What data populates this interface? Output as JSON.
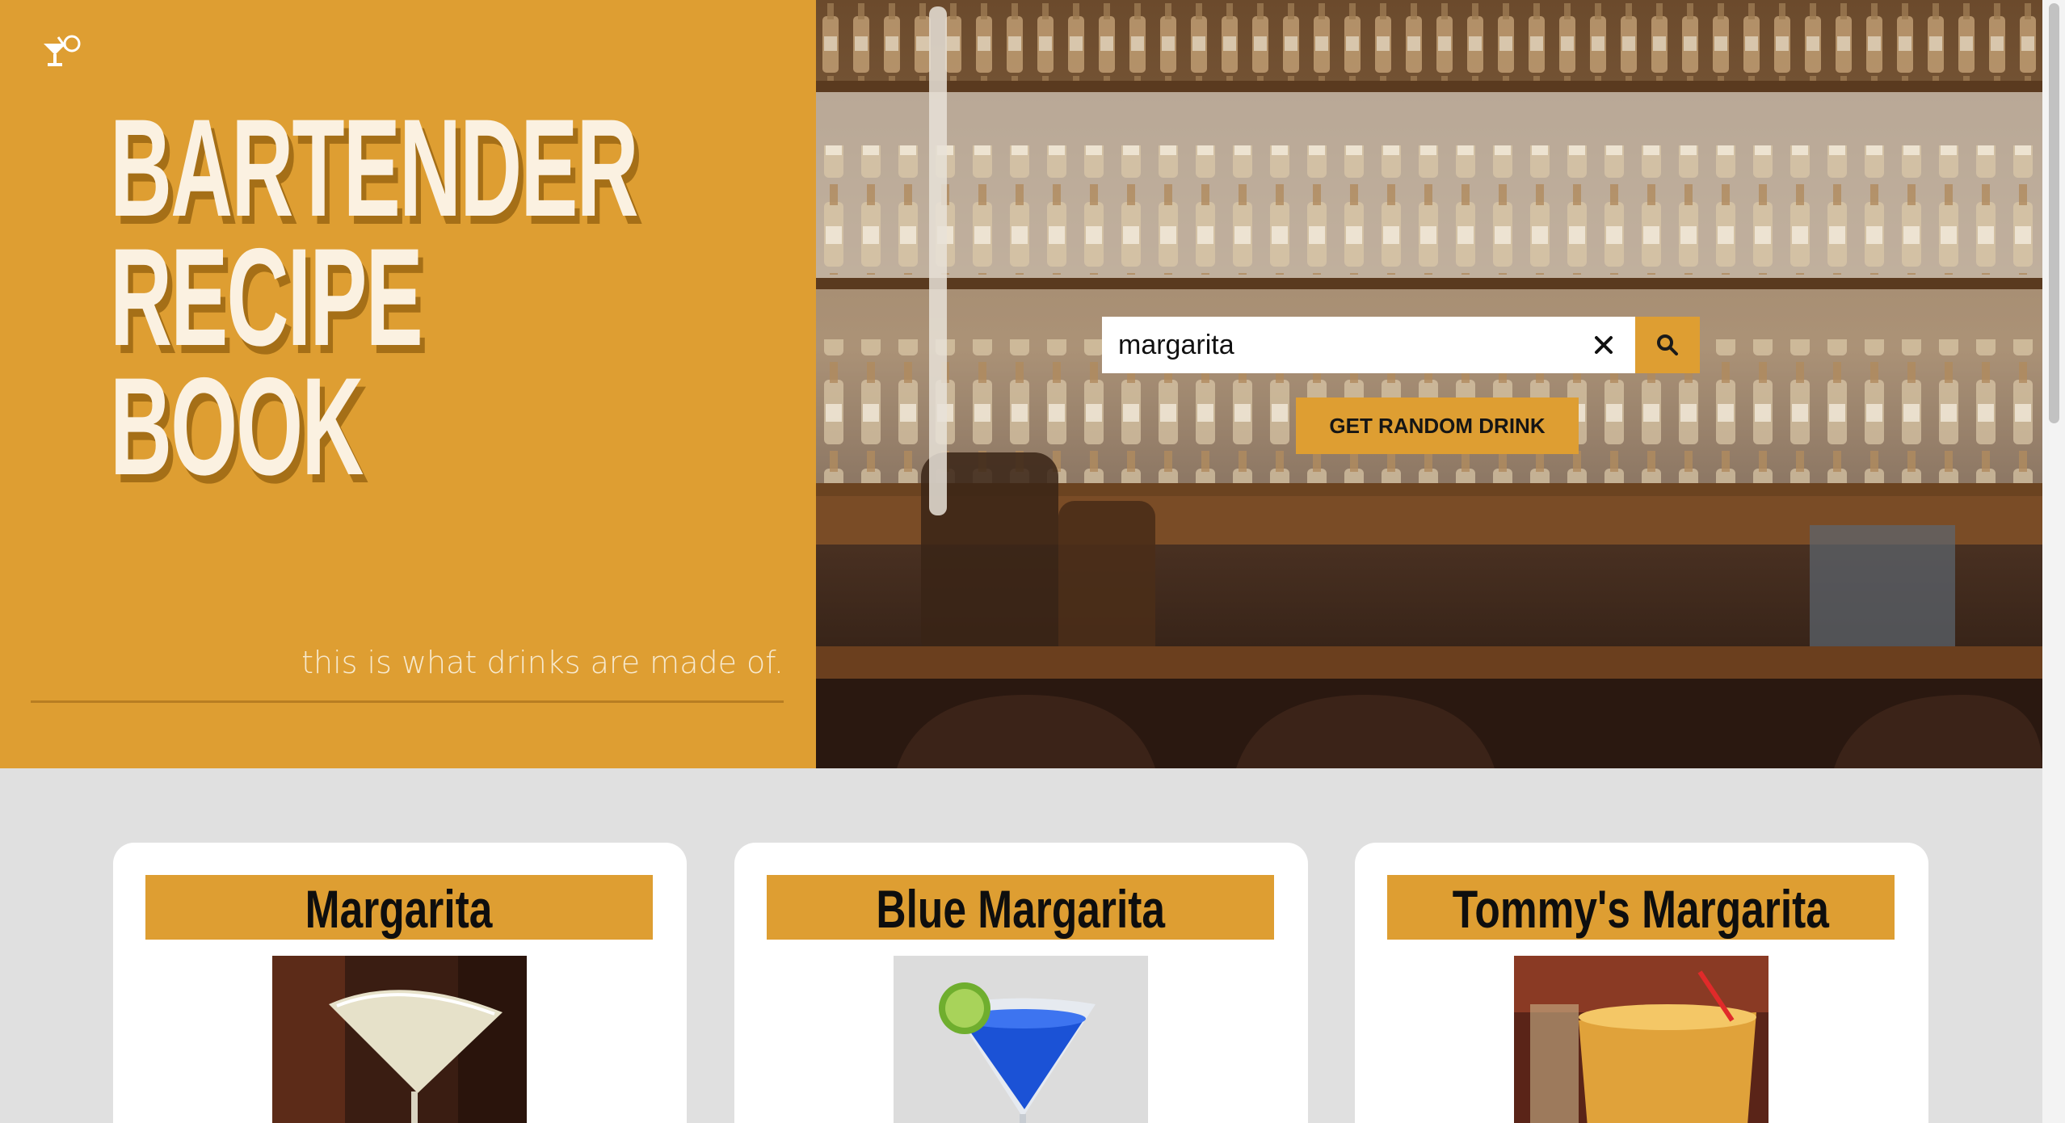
{
  "hero": {
    "title_lines": [
      "BARTENDER",
      "RECIPE",
      "BOOK"
    ],
    "tagline": "this is what drinks are made of.",
    "logo_icon": "cocktail-icon"
  },
  "search": {
    "value": "margarita",
    "clear_icon": "close-icon",
    "search_icon": "search-icon"
  },
  "random_button": {
    "label": "GET RANDOM DRINK"
  },
  "colors": {
    "accent": "#de9e32",
    "title_text": "#fbf1e1",
    "background": "#e0e0e0"
  },
  "results": [
    {
      "name": "Margarita"
    },
    {
      "name": "Blue Margarita"
    },
    {
      "name": "Tommy's Margarita"
    }
  ]
}
